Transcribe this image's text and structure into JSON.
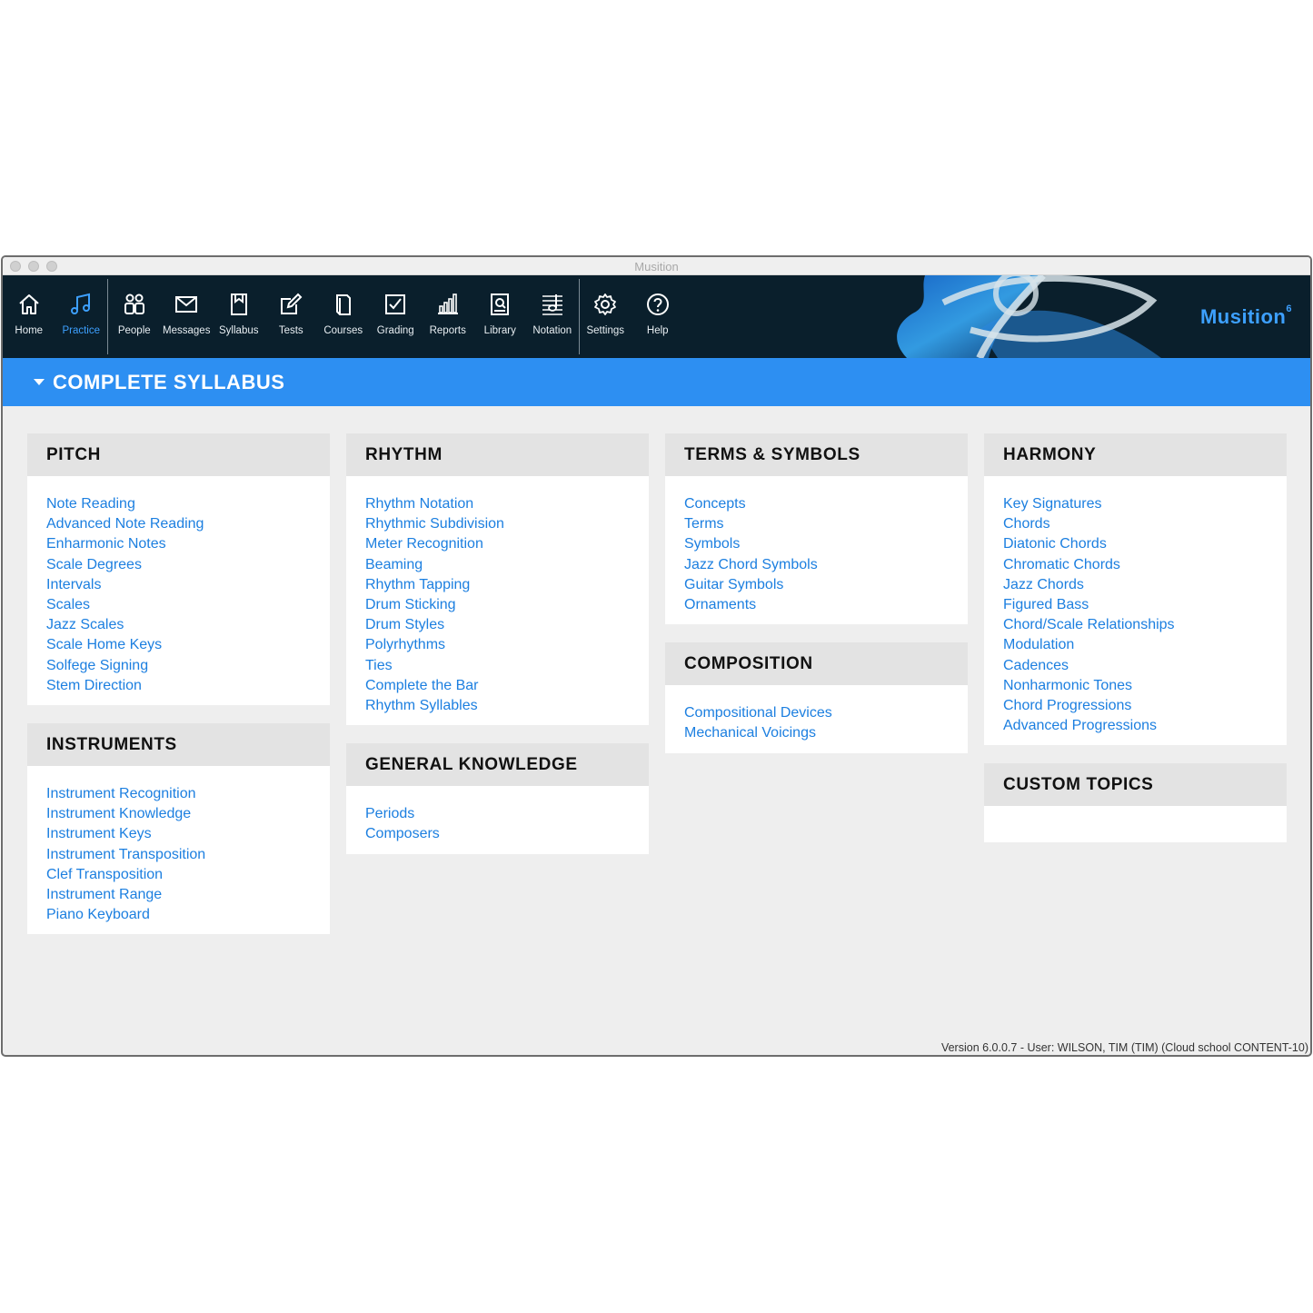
{
  "window": {
    "title": "Musition"
  },
  "nav": [
    {
      "label": "Home",
      "icon": "home-icon"
    },
    {
      "label": "Practice",
      "icon": "music-note-icon",
      "active": true
    },
    {
      "label": "People",
      "icon": "people-icon"
    },
    {
      "label": "Messages",
      "icon": "envelope-icon"
    },
    {
      "label": "Syllabus",
      "icon": "syllabus-icon"
    },
    {
      "label": "Tests",
      "icon": "edit-icon"
    },
    {
      "label": "Courses",
      "icon": "book-icon"
    },
    {
      "label": "Grading",
      "icon": "checkbox-icon"
    },
    {
      "label": "Reports",
      "icon": "bar-chart-icon"
    },
    {
      "label": "Library",
      "icon": "library-icon"
    },
    {
      "label": "Notation",
      "icon": "notation-icon"
    },
    {
      "label": "Settings",
      "icon": "gear-icon"
    },
    {
      "label": "Help",
      "icon": "help-icon"
    }
  ],
  "brand": {
    "name": "Musition",
    "superscript": "6"
  },
  "banner": {
    "title": "COMPLETE SYLLABUS"
  },
  "colors": {
    "accent": "#2d8ff2",
    "link": "#1c7fe0",
    "toolbar": "#0a1f2c"
  },
  "columns": [
    [
      {
        "title": "PITCH",
        "items": [
          "Note Reading",
          "Advanced Note Reading",
          "Enharmonic Notes",
          "Scale Degrees",
          "Intervals",
          "Scales",
          "Jazz Scales",
          "Scale Home Keys",
          "Solfege Signing",
          "Stem Direction"
        ]
      },
      {
        "title": "INSTRUMENTS",
        "items": [
          "Instrument Recognition",
          "Instrument Knowledge",
          "Instrument Keys",
          "Instrument Transposition",
          "Clef Transposition",
          "Instrument Range",
          "Piano Keyboard"
        ]
      }
    ],
    [
      {
        "title": "RHYTHM",
        "items": [
          "Rhythm Notation",
          "Rhythmic Subdivision",
          "Meter Recognition",
          "Beaming",
          "Rhythm Tapping",
          "Drum Sticking",
          "Drum Styles",
          "Polyrhythms",
          "Ties",
          "Complete the Bar",
          "Rhythm Syllables"
        ]
      },
      {
        "title": "GENERAL KNOWLEDGE",
        "items": [
          "Periods",
          "Composers"
        ]
      }
    ],
    [
      {
        "title": "TERMS & SYMBOLS",
        "items": [
          "Concepts",
          "Terms",
          "Symbols",
          "Jazz Chord Symbols",
          "Guitar Symbols",
          "Ornaments"
        ]
      },
      {
        "title": "COMPOSITION",
        "items": [
          "Compositional Devices",
          "Mechanical Voicings"
        ]
      }
    ],
    [
      {
        "title": "HARMONY",
        "items": [
          "Key Signatures",
          "Chords",
          "Diatonic Chords",
          "Chromatic Chords",
          "Jazz Chords",
          "Figured Bass",
          "Chord/Scale Relationships",
          "Modulation",
          "Cadences",
          "Nonharmonic Tones",
          "Chord Progressions",
          "Advanced Progressions"
        ]
      },
      {
        "title": "CUSTOM TOPICS",
        "items": []
      }
    ]
  ],
  "status": {
    "text": "Version 6.0.0.7 - User: WILSON, TIM (TIM) (Cloud school CONTENT-10)"
  }
}
